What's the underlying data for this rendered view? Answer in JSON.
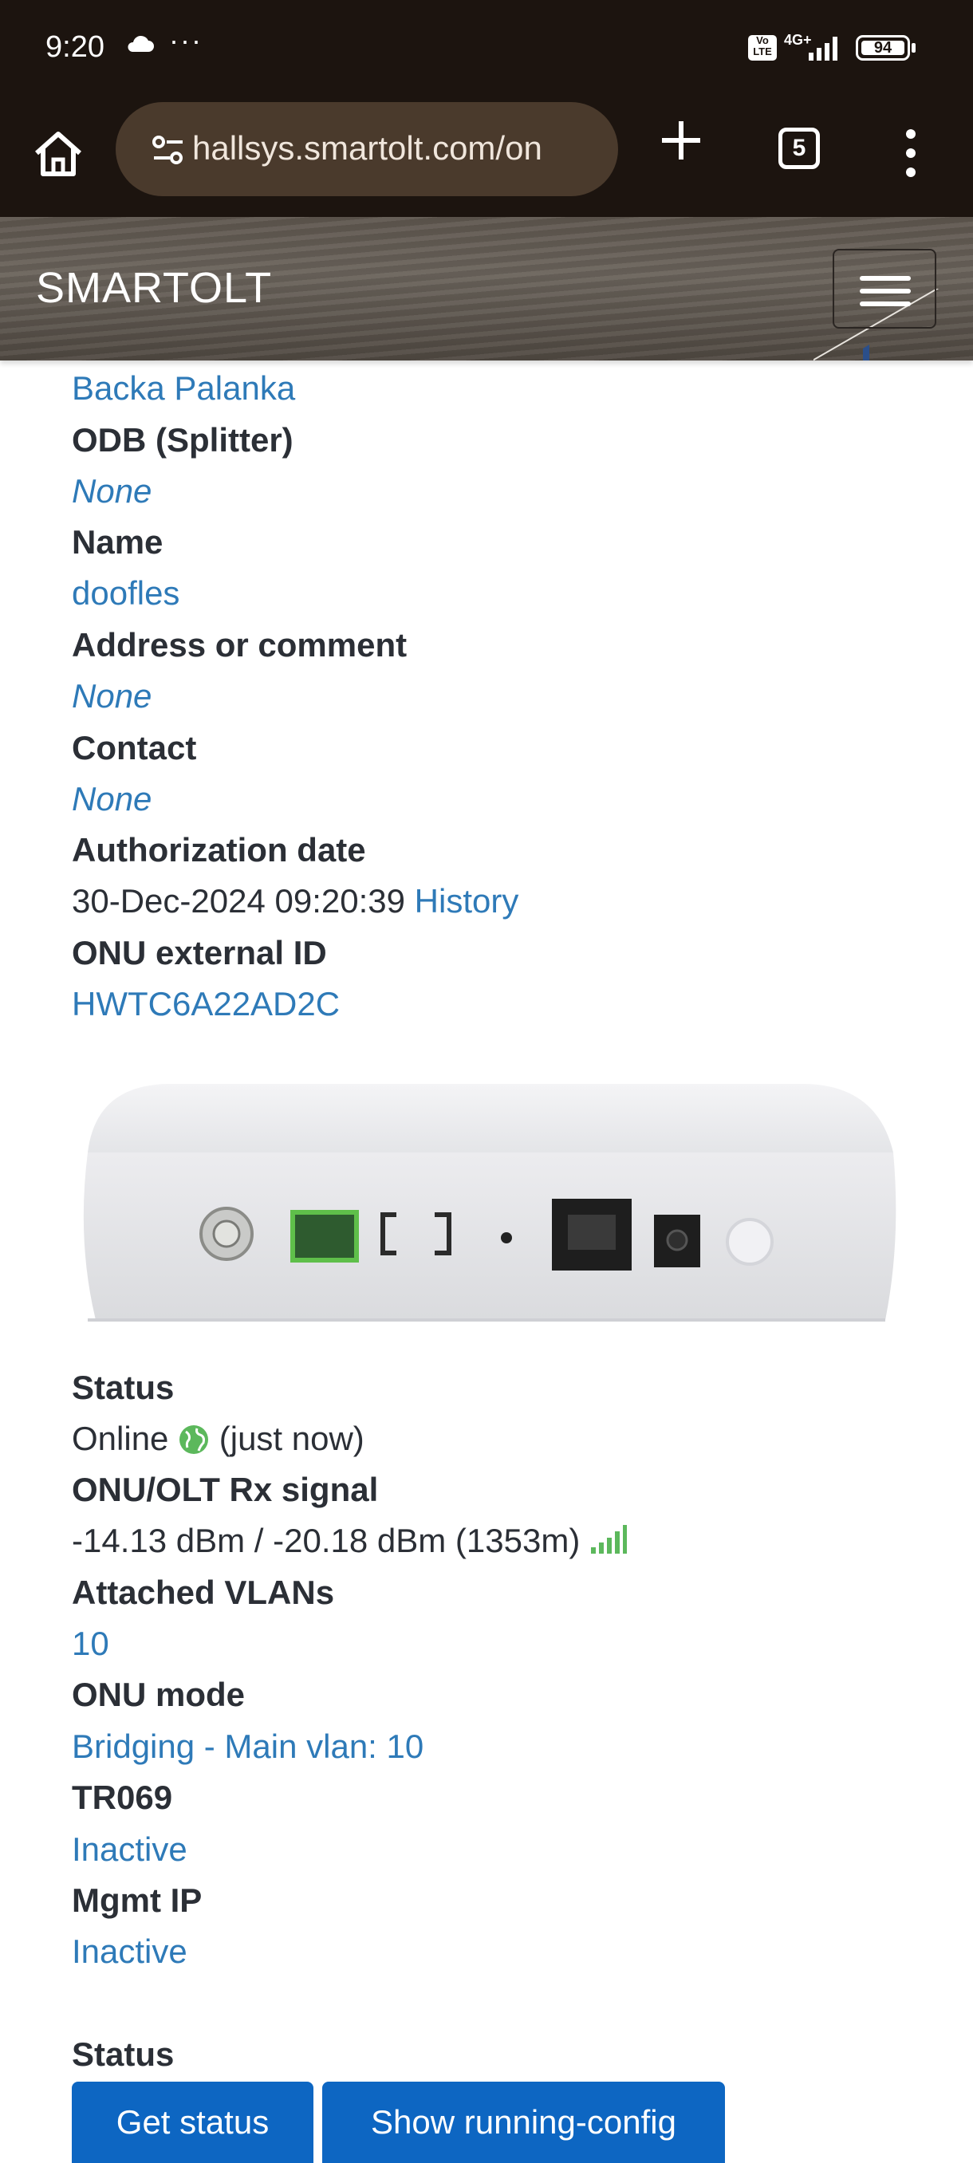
{
  "status_bar": {
    "time": "9:20",
    "dots": "···",
    "network": "4G+",
    "volte": "Vo LTE",
    "battery": "94"
  },
  "browser": {
    "url": "hallsys.smartolt.com/on",
    "tabs_count": "5"
  },
  "navbar": {
    "brand": "SMARTOLT"
  },
  "details": {
    "zone_value": "Backa Palanka",
    "odb_label": "ODB (Splitter)",
    "odb_value": "None",
    "name_label": "Name",
    "name_value": "doofles",
    "address_label": "Address or comment",
    "address_value": "None",
    "contact_label": "Contact",
    "contact_value": "None",
    "auth_date_label": "Authorization date",
    "auth_date_value": "30-Dec-2024 09:20:39",
    "history_link": "History",
    "external_id_label": "ONU external ID",
    "external_id_value": "HWTC6A22AD2C",
    "status_label": "Status",
    "status_value": "Online",
    "status_time": "(just now)",
    "signal_label": "ONU/OLT Rx signal",
    "signal_value": "-14.13 dBm / -20.18 dBm (1353m)",
    "vlans_label": "Attached VLANs",
    "vlans_value": "10",
    "mode_label": "ONU mode",
    "mode_value": "Bridging - Main vlan: 10",
    "tr069_label": "TR069",
    "tr069_value": "Inactive",
    "mgmt_label": "Mgmt IP",
    "mgmt_value": "Inactive"
  },
  "actions": {
    "section_label": "Status",
    "get_status": "Get status",
    "show_config": "Show running-config"
  },
  "colors": {
    "link": "#2e7ab8",
    "button": "#0d66c2",
    "online": "#5cb85c"
  }
}
